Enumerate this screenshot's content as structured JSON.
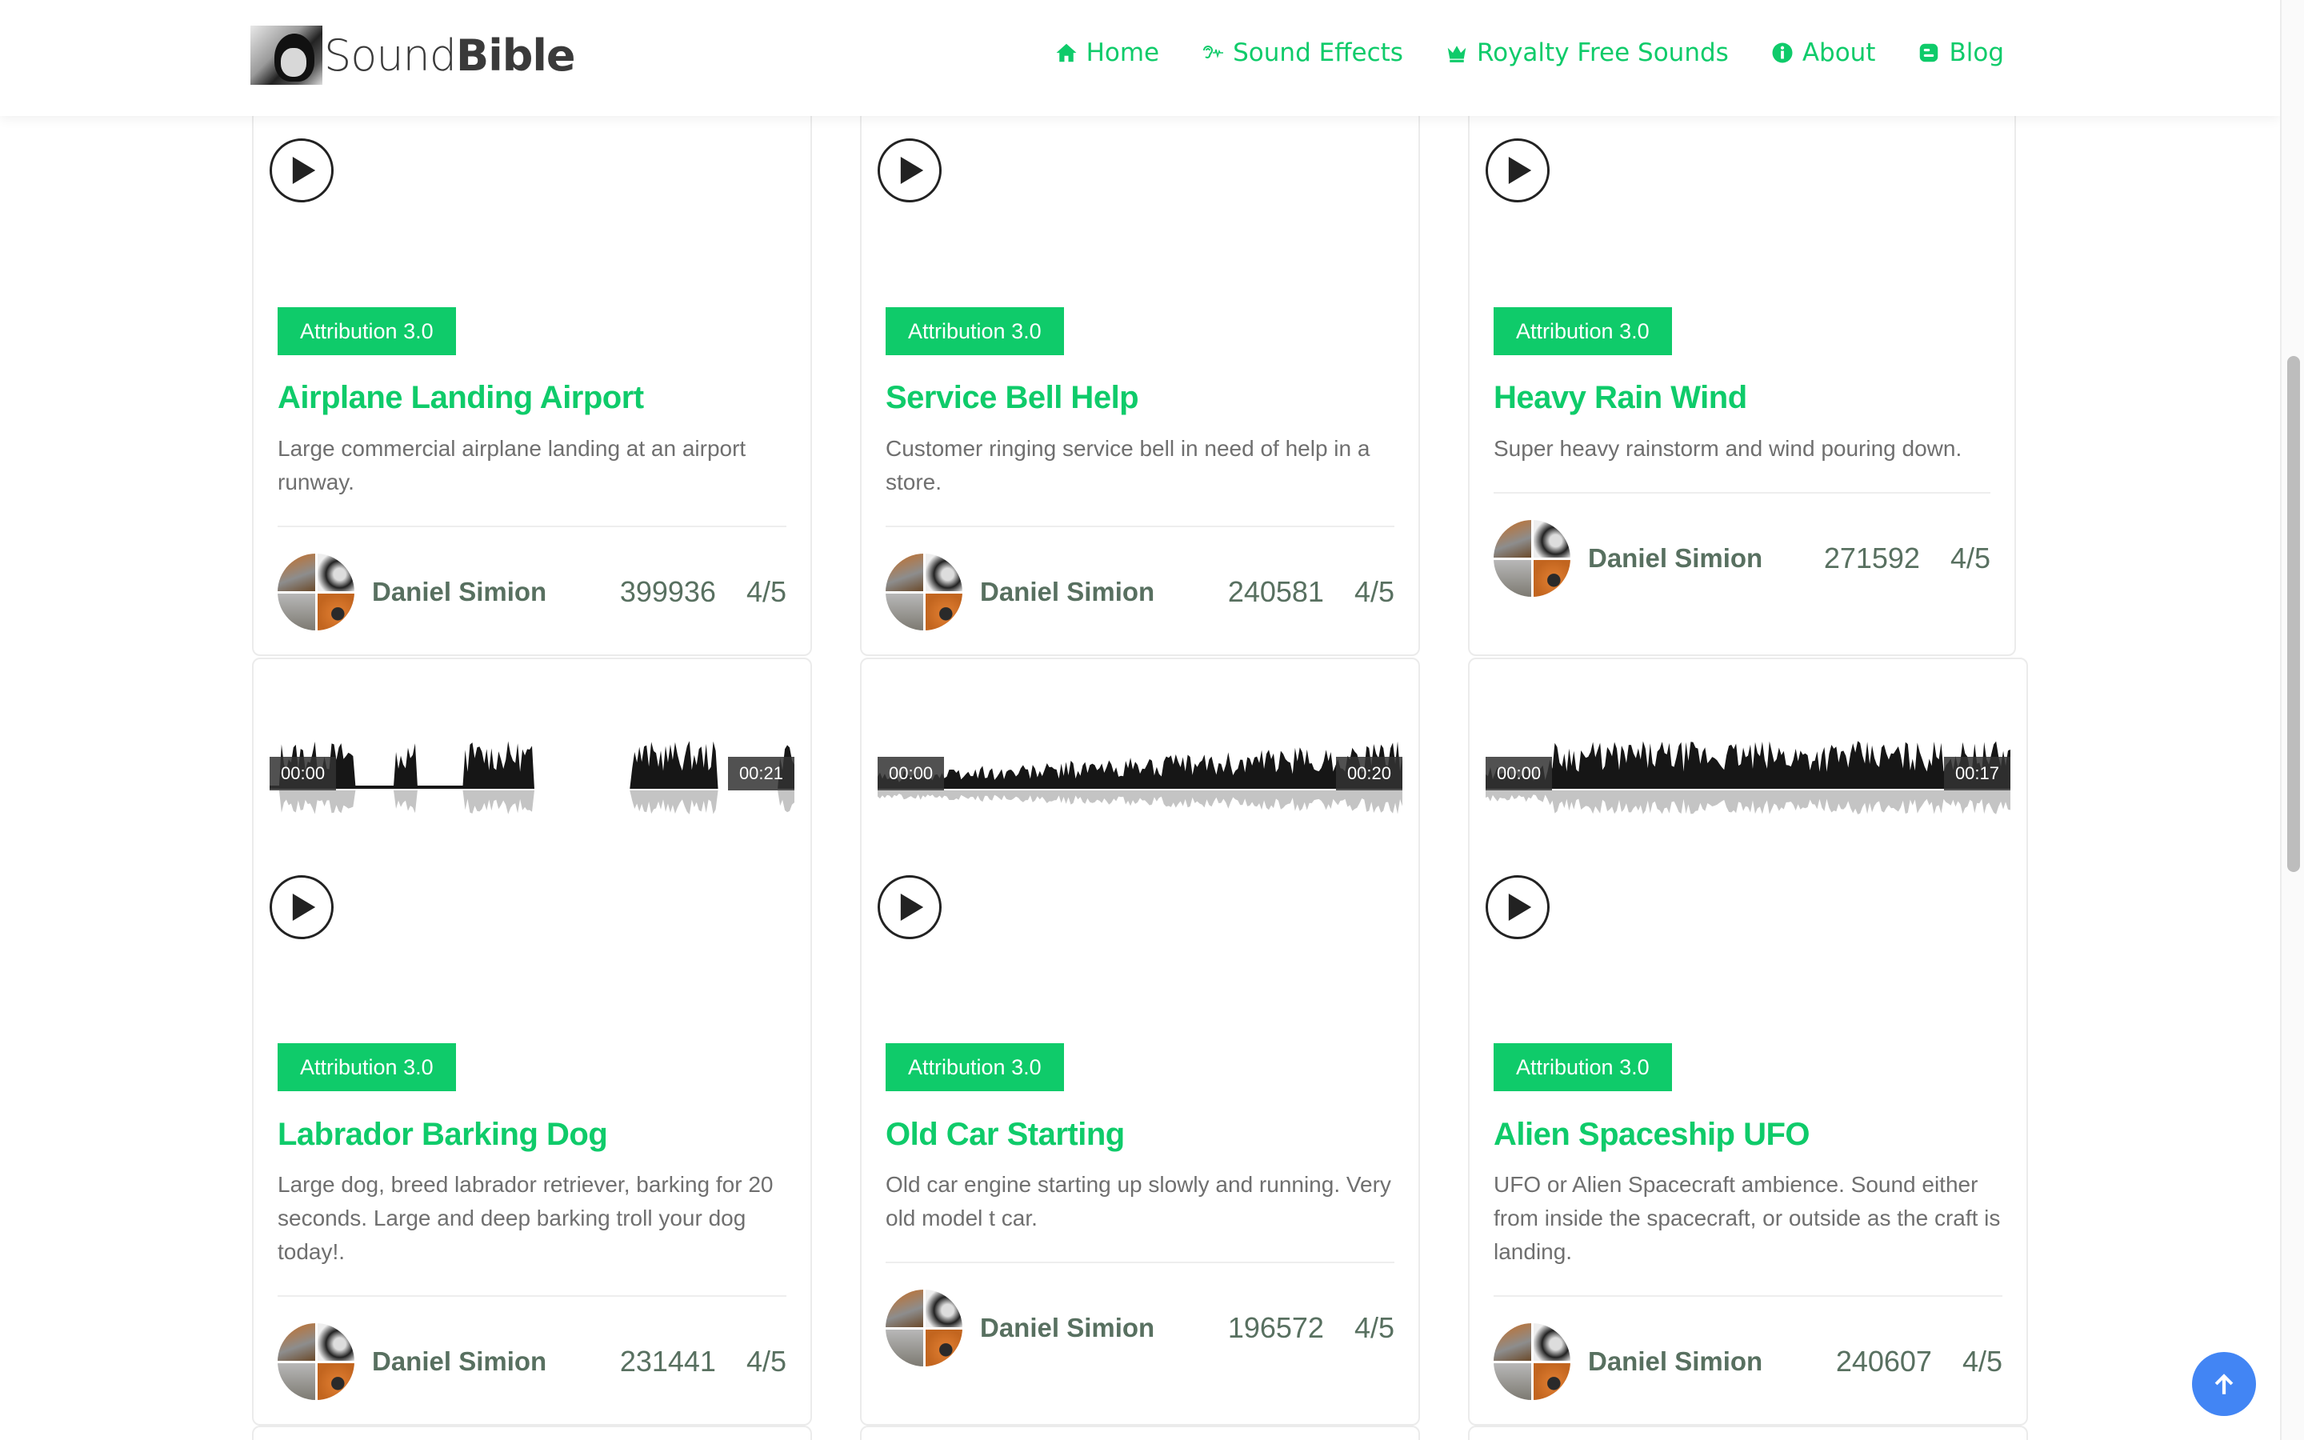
{
  "brand": {
    "name_light": "Sound",
    "name_bold": "Bible"
  },
  "nav": [
    {
      "label": "Home",
      "icon": "home-icon"
    },
    {
      "label": "Sound Effects",
      "icon": "ear-icon"
    },
    {
      "label": "Royalty Free Sounds",
      "icon": "crown-icon"
    },
    {
      "label": "About",
      "icon": "info-icon"
    },
    {
      "label": "Blog",
      "icon": "blogger-icon"
    }
  ],
  "colors": {
    "accent": "#0fcb6a",
    "meta_text": "#587060",
    "scroll_top_button": "#4285f4"
  },
  "sounds": [
    {
      "license": "Attribution 3.0",
      "title": "Airplane Landing Airport",
      "description": "Large commercial airplane landing at an airport runway.",
      "author": "Daniel Simion",
      "downloads": "399936",
      "rating": "4/5"
    },
    {
      "license": "Attribution 3.0",
      "title": "Service Bell Help",
      "description": "Customer ringing service bell in need of help in a store.",
      "author": "Daniel Simion",
      "downloads": "240581",
      "rating": "4/5"
    },
    {
      "license": "Attribution 3.0",
      "title": "Heavy Rain Wind",
      "description": "Super heavy rainstorm and wind pouring down.",
      "author": "Daniel Simion",
      "downloads": "271592",
      "rating": "4/5"
    },
    {
      "license": "Attribution 3.0",
      "title": "Labrador Barking Dog",
      "description": "Large dog, breed labrador retriever, barking for 20 seconds. Large and deep barking troll your dog today!.",
      "author": "Daniel Simion",
      "downloads": "231441",
      "rating": "4/5",
      "time_start": "00:00",
      "time_end": "00:21"
    },
    {
      "license": "Attribution 3.0",
      "title": "Old Car Starting",
      "description": "Old car engine starting up slowly and running. Very old model t car.",
      "author": "Daniel Simion",
      "downloads": "196572",
      "rating": "4/5",
      "time_start": "00:00",
      "time_end": "00:20"
    },
    {
      "license": "Attribution 3.0",
      "title": "Alien Spaceship UFO",
      "description": "UFO or Alien Spacecraft ambience. Sound either from inside the spacecraft, or outside as the craft is landing.",
      "author": "Daniel Simion",
      "downloads": "240607",
      "rating": "4/5",
      "time_start": "00:00",
      "time_end": "00:17"
    }
  ]
}
